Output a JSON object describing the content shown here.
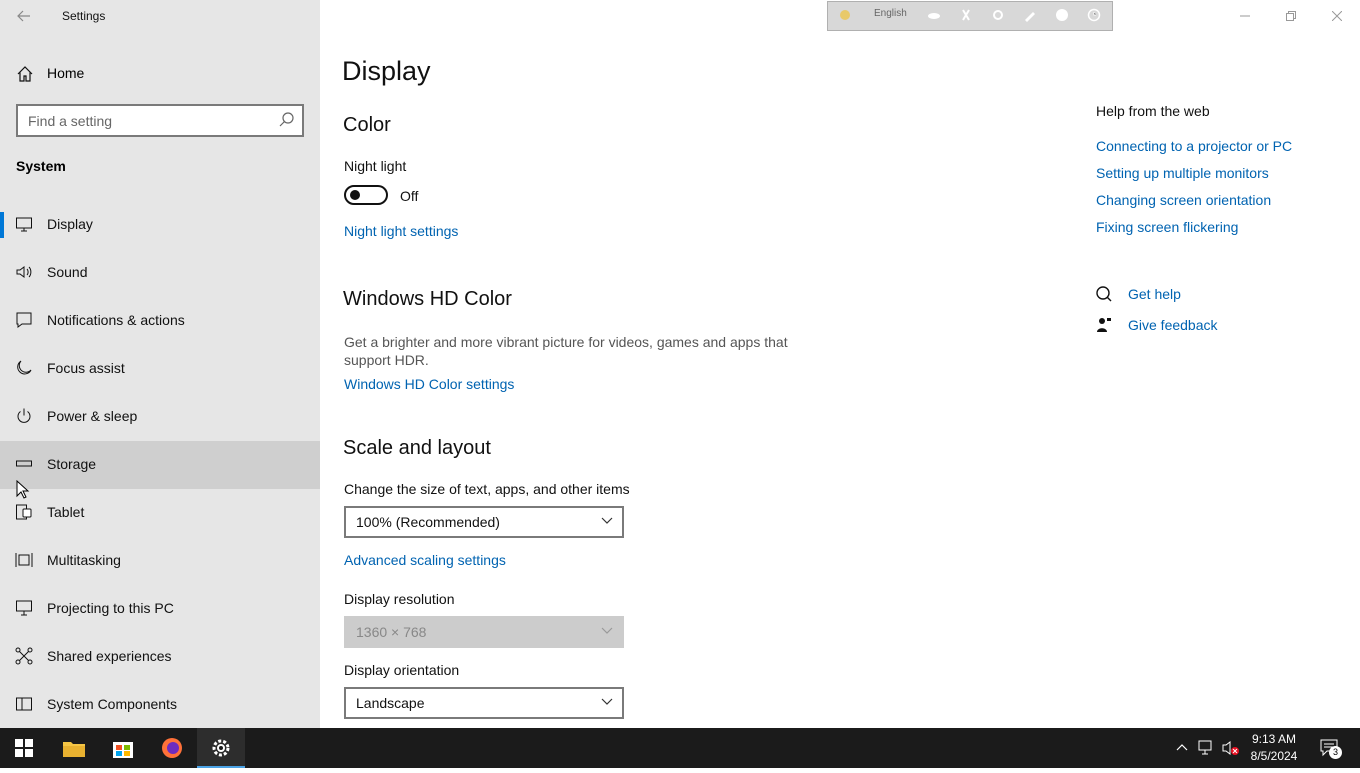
{
  "app": {
    "title": "Settings"
  },
  "sidebar": {
    "home_label": "Home",
    "search_placeholder": "Find a setting",
    "section_label": "System",
    "items": [
      {
        "label": "Display",
        "icon": "monitor-icon",
        "selected": true
      },
      {
        "label": "Sound",
        "icon": "speaker-icon"
      },
      {
        "label": "Notifications & actions",
        "icon": "notification-icon"
      },
      {
        "label": "Focus assist",
        "icon": "moon-icon"
      },
      {
        "label": "Power & sleep",
        "icon": "power-icon"
      },
      {
        "label": "Storage",
        "icon": "storage-icon",
        "hover": true
      },
      {
        "label": "Tablet",
        "icon": "tablet-icon"
      },
      {
        "label": "Multitasking",
        "icon": "multitasking-icon"
      },
      {
        "label": "Projecting to this PC",
        "icon": "projector-icon"
      },
      {
        "label": "Shared experiences",
        "icon": "shared-icon"
      },
      {
        "label": "System Components",
        "icon": "components-icon"
      }
    ]
  },
  "ime_bar": {
    "language": "English"
  },
  "main": {
    "page_title": "Display",
    "color": {
      "heading": "Color",
      "night_light_label": "Night light",
      "night_light_state": "Off",
      "night_light_link": "Night light settings"
    },
    "hdr": {
      "heading": "Windows HD Color",
      "description": "Get a brighter and more vibrant picture for videos, games and apps that support HDR.",
      "link": "Windows HD Color settings"
    },
    "scale": {
      "heading": "Scale and layout",
      "size_label": "Change the size of text, apps, and other items",
      "size_value": "100% (Recommended)",
      "advanced_link": "Advanced scaling settings",
      "resolution_label": "Display resolution",
      "resolution_value": "1360 × 768",
      "orientation_label": "Display orientation",
      "orientation_value": "Landscape"
    }
  },
  "help": {
    "heading": "Help from the web",
    "links": [
      "Connecting to a projector or PC",
      "Setting up multiple monitors",
      "Changing screen orientation",
      "Fixing screen flickering"
    ],
    "get_help": "Get help",
    "give_feedback": "Give feedback"
  },
  "taskbar": {
    "time": "9:13 AM",
    "date": "8/5/2024",
    "notification_count": "3"
  },
  "colors": {
    "accent": "#0078d7",
    "link": "#0063b1",
    "sidebar_bg": "#e6e6e6",
    "taskbar_bg": "#1b1b1b"
  }
}
